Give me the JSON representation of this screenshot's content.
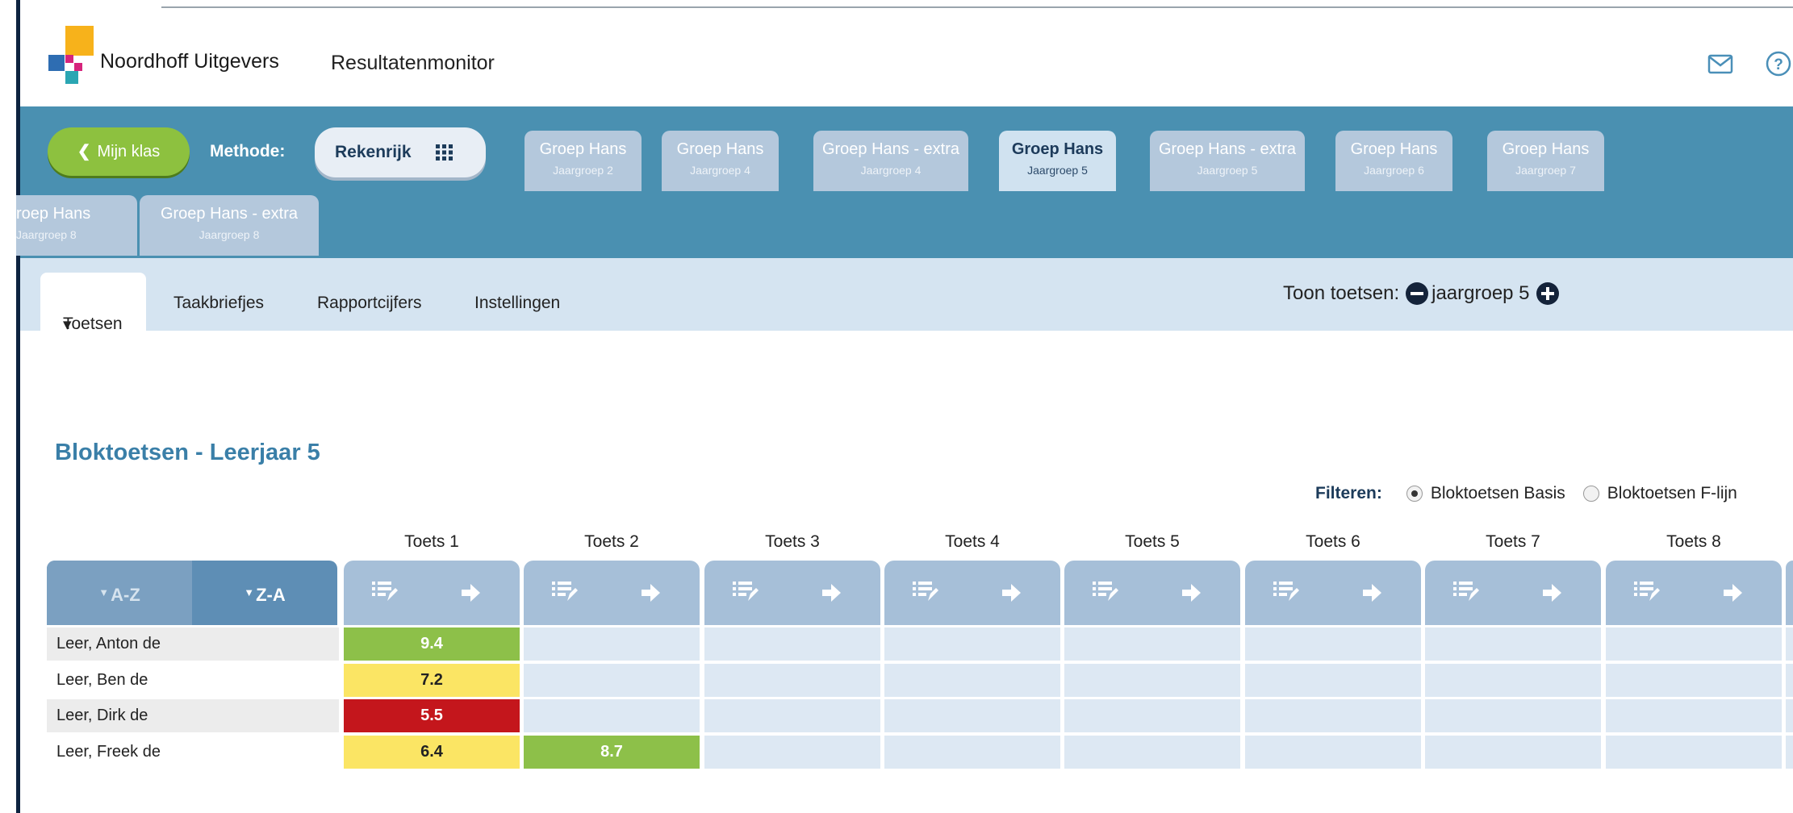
{
  "header": {
    "brand": "Noordhoff Uitgevers",
    "app_title": "Resultatenmonitor"
  },
  "bluebar": {
    "back_label": "Mijn klas",
    "methode_label": "Methode:",
    "methode_value": "Rekenrijk",
    "group_tabs": [
      {
        "name": "Groep Hans",
        "sub": "Jaargroep 2"
      },
      {
        "name": "Groep Hans",
        "sub": "Jaargroep 4"
      },
      {
        "name": "Groep Hans - extra",
        "sub": "Jaargroep 4"
      },
      {
        "name": "Groep Hans",
        "sub": "Jaargroep 5",
        "active": true
      },
      {
        "name": "Groep Hans - extra",
        "sub": "Jaargroep 5"
      },
      {
        "name": "Groep Hans",
        "sub": "Jaargroep 6"
      },
      {
        "name": "Groep Hans",
        "sub": "Jaargroep 7"
      },
      {
        "name": "roep Hans",
        "sub": "Jaargroep 8"
      },
      {
        "name": "Groep Hans - extra",
        "sub": "Jaargroep 8"
      }
    ]
  },
  "subnav": {
    "tabs": [
      "Toetsen",
      "Taakbriefjes",
      "Rapportcijfers",
      "Instellingen"
    ],
    "toon_label": "Toon toetsen:",
    "toon_value": "jaargroep 5"
  },
  "content": {
    "section_title": "Bloktoetsen - Leerjaar 5",
    "filter_label": "Filteren:",
    "filter_options": [
      {
        "label": "Bloktoetsen Basis",
        "selected": true
      },
      {
        "label": "Bloktoetsen F-lijn",
        "selected": false
      }
    ],
    "sort_az": "A-Z",
    "sort_za": "Z-A",
    "columns": [
      "Toets 1",
      "Toets 2",
      "Toets 3",
      "Toets 4",
      "Toets 5",
      "Toets 6",
      "Toets 7",
      "Toets 8"
    ],
    "students": [
      {
        "name": "Leer, Anton de",
        "scores": [
          "9.4",
          "",
          "",
          "",
          "",
          "",
          "",
          ""
        ]
      },
      {
        "name": "Leer, Ben de",
        "scores": [
          "7.2",
          "",
          "",
          "",
          "",
          "",
          "",
          ""
        ]
      },
      {
        "name": "Leer, Dirk de",
        "scores": [
          "5.5",
          "",
          "",
          "",
          "",
          "",
          "",
          ""
        ]
      },
      {
        "name": "Leer, Freek de",
        "scores": [
          "6.4",
          "8.7",
          "",
          "",
          "",
          "",
          "",
          ""
        ]
      }
    ]
  },
  "colors": {
    "header_blue": "#4a90b1",
    "green_score": "#8dc049",
    "yellow_score": "#fbe564",
    "red_score": "#c4161c",
    "accent_title": "#3a7fa8"
  }
}
